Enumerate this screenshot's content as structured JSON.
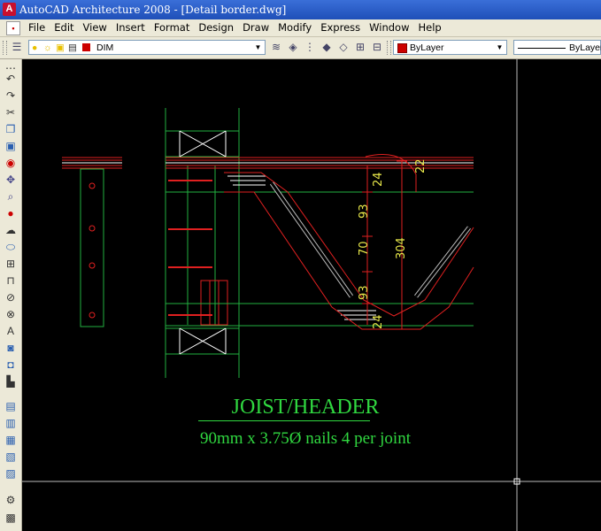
{
  "window": {
    "title": "AutoCAD Architecture 2008 - [Detail border.dwg]"
  },
  "menu": {
    "items": [
      "File",
      "Edit",
      "View",
      "Insert",
      "Format",
      "Design",
      "Draw",
      "Modify",
      "Express",
      "Window",
      "Help"
    ]
  },
  "toolbar": {
    "layer_value": "DIM",
    "color_value": "ByLayer",
    "linetype_value": "ByLayer"
  },
  "colors": {
    "accent_green": "#30d840",
    "dim_yellow": "#e8e84a",
    "line_red": "#e02020",
    "line_green": "#22b040"
  },
  "drawing": {
    "title": "JOIST/HEADER",
    "note": "90mm x 3.75Ø nails 4 per joint",
    "dimensions": {
      "d24_top": "24",
      "d22": "22",
      "d93_top": "93",
      "d70": "70",
      "d304": "304",
      "d93_bottom": "93",
      "d24_bottom": "24"
    }
  }
}
